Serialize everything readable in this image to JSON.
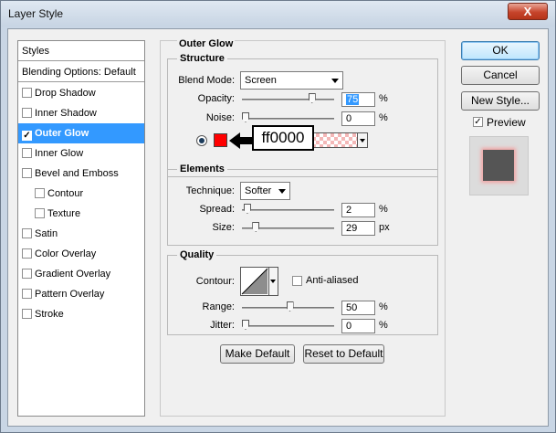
{
  "window": {
    "title": "Layer Style",
    "close": "X"
  },
  "styles_list": {
    "header": "Styles",
    "blending": "Blending Options: Default",
    "items": [
      {
        "label": "Drop Shadow",
        "checked": false
      },
      {
        "label": "Inner Shadow",
        "checked": false
      },
      {
        "label": "Outer Glow",
        "checked": true
      },
      {
        "label": "Inner Glow",
        "checked": false
      },
      {
        "label": "Bevel and Emboss",
        "checked": false
      },
      {
        "label": "Contour",
        "checked": false
      },
      {
        "label": "Texture",
        "checked": false
      },
      {
        "label": "Satin",
        "checked": false
      },
      {
        "label": "Color Overlay",
        "checked": false
      },
      {
        "label": "Gradient Overlay",
        "checked": false
      },
      {
        "label": "Pattern Overlay",
        "checked": false
      },
      {
        "label": "Stroke",
        "checked": false
      }
    ]
  },
  "outer_glow": {
    "title": "Outer Glow",
    "structure": {
      "title": "Structure",
      "blend_mode_label": "Blend Mode:",
      "blend_mode_value": "Screen",
      "opacity_label": "Opacity:",
      "opacity_value": "75",
      "opacity_level": 75,
      "noise_label": "Noise:",
      "noise_value": "0",
      "noise_level": 0,
      "unit": "%",
      "glow_color": "#ff0000",
      "callout_text": "ff0000"
    },
    "elements": {
      "title": "Elements",
      "technique_label": "Technique:",
      "technique_value": "Softer",
      "spread_label": "Spread:",
      "spread_value": "2",
      "spread_level": 2,
      "spread_unit": "%",
      "size_label": "Size:",
      "size_value": "29",
      "size_level": 11.6,
      "size_unit": "px"
    },
    "quality": {
      "title": "Quality",
      "contour_label": "Contour:",
      "anti_aliased_label": "Anti-aliased",
      "range_label": "Range:",
      "range_value": "50",
      "range_level": 50,
      "jitter_label": "Jitter:",
      "jitter_value": "0",
      "jitter_level": 0,
      "unit": "%"
    },
    "make_default": "Make Default",
    "reset_default": "Reset to Default"
  },
  "actions": {
    "ok": "OK",
    "cancel": "Cancel",
    "new_style": "New Style...",
    "preview_label": "Preview",
    "preview_checked": true
  },
  "colors": {
    "selection": "#3399ff",
    "glow": "#ff0000"
  }
}
